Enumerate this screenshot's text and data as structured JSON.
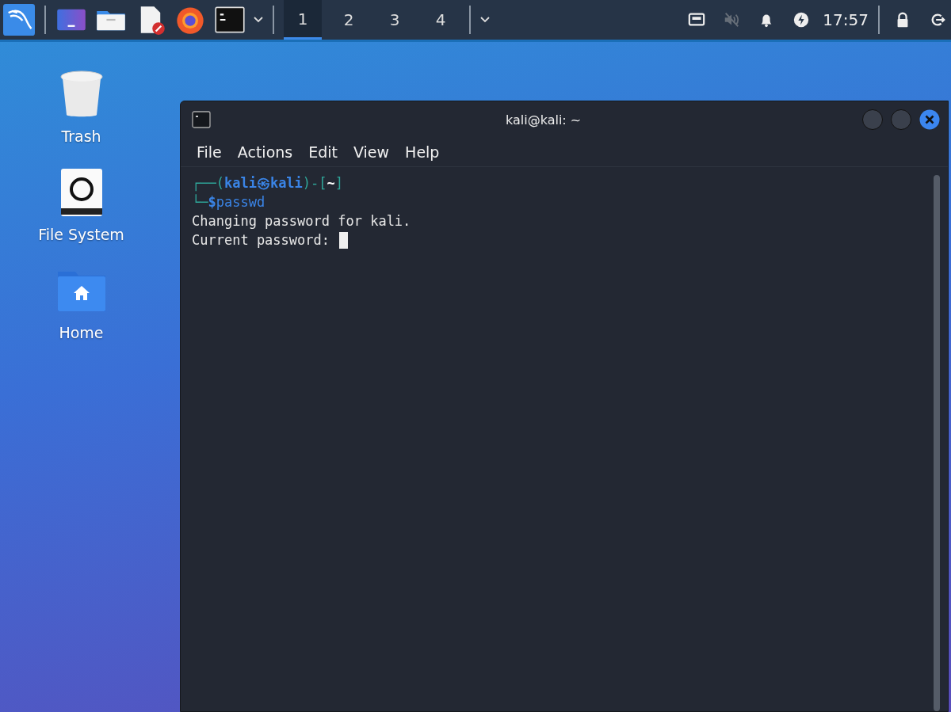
{
  "panel": {
    "launchers": [
      {
        "kind": "kali"
      },
      {
        "kind": "desktop"
      },
      {
        "kind": "folder"
      },
      {
        "kind": "editor"
      },
      {
        "kind": "firefox"
      },
      {
        "kind": "terminal"
      }
    ],
    "workspaces": [
      {
        "label": "1",
        "selected": true
      },
      {
        "label": "2",
        "selected": false
      },
      {
        "label": "3",
        "selected": false
      },
      {
        "label": "4",
        "selected": false
      }
    ],
    "clock": "17:57",
    "sound_muted": true
  },
  "desktop_icons": [
    {
      "kind": "trash",
      "label": "Trash"
    },
    {
      "kind": "drive",
      "label": "File System"
    },
    {
      "kind": "home",
      "label": "Home"
    }
  ],
  "window": {
    "title": "kali@kali: ~",
    "menu": [
      "File",
      "Actions",
      "Edit",
      "View",
      "Help"
    ],
    "prompt": {
      "open": "┌──(",
      "user": "kali",
      "at": "㉿",
      "host": "kali",
      "mid": ")-[",
      "cwd": "~",
      "close": "]",
      "corner": "└─",
      "dollar": "$",
      "command": "passwd"
    },
    "output": [
      "Changing password for kali.",
      "Current password:"
    ],
    "cursor": true
  }
}
